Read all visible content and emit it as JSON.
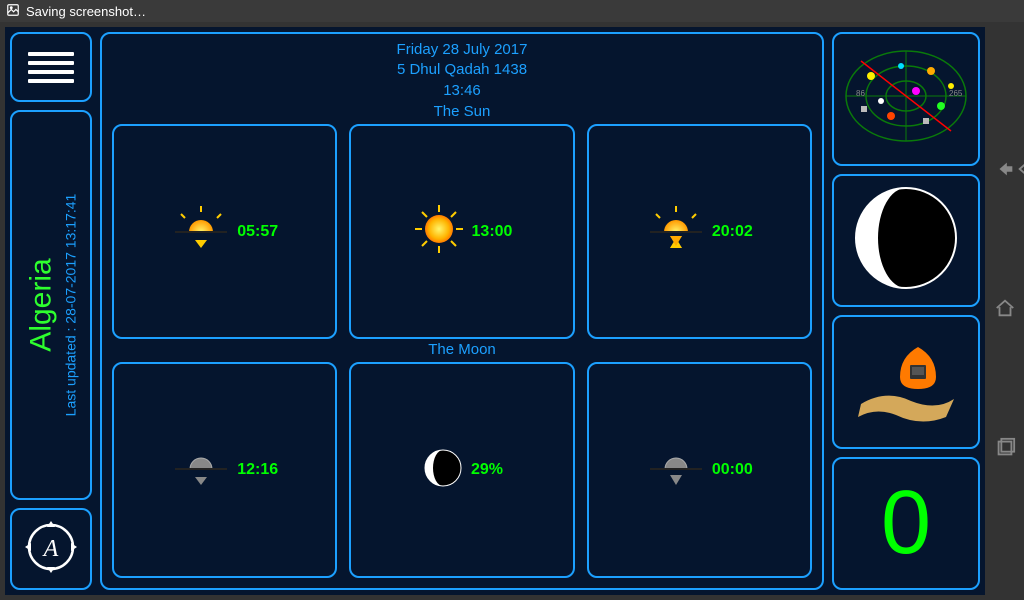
{
  "status": {
    "text": "Saving screenshot…"
  },
  "location": {
    "name": "Algeria",
    "last_updated": "Last updated : 28-07-2017 13:17:41"
  },
  "header": {
    "gregorian": "Friday 28 July 2017",
    "hijri": "5 Dhul Qadah 1438",
    "time": "13:46"
  },
  "sun": {
    "label": "The Sun",
    "rise": "05:57",
    "transit": "13:00",
    "set": "20:02"
  },
  "moon": {
    "label": "The Moon",
    "rise": "12:16",
    "phase": "29%",
    "set": "00:00"
  },
  "counter": "0"
}
